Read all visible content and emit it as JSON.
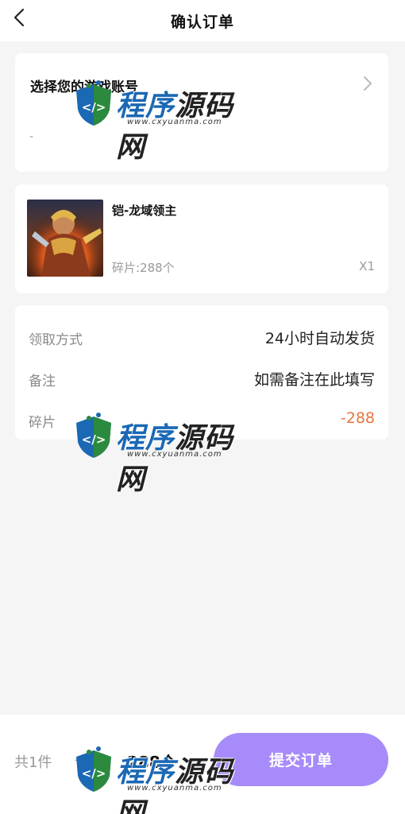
{
  "header": {
    "title": "确认订单",
    "back_icon": "chevron-left-icon"
  },
  "account": {
    "title": "选择您的游戏账号",
    "value": "-",
    "chevron_icon": "chevron-right-icon"
  },
  "product": {
    "name": "铠-龙域领主",
    "price": "碎片:288个",
    "quantity": "X1"
  },
  "details": [
    {
      "label": "领取方式",
      "value": "24小时自动发货"
    },
    {
      "label": "备注",
      "value": "如需备注在此填写"
    },
    {
      "label": "碎片",
      "value": "-288"
    }
  ],
  "footer": {
    "count": "共1件",
    "total_label": "合计:",
    "total_amount": "288个",
    "submit_label": "提交订单"
  },
  "watermark": {
    "brand_blue": "程序",
    "brand_dark": "源码网",
    "url": "www.cxyuanma.com"
  },
  "colors": {
    "accent_orange": "#e8763d",
    "submit_purple": "#a78bfa",
    "background": "#f5f5f5"
  }
}
